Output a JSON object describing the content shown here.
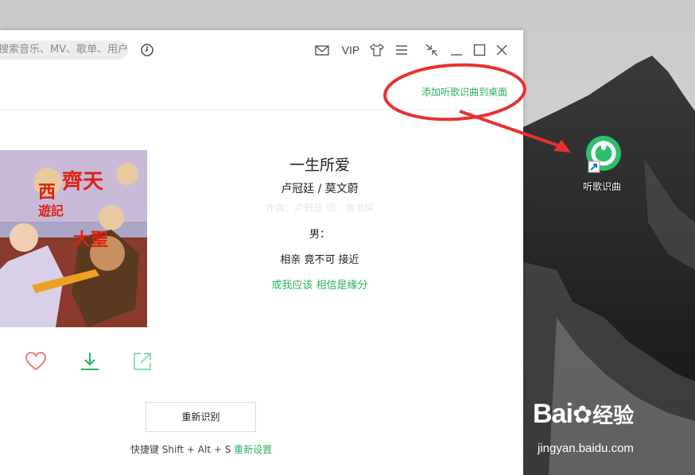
{
  "search": {
    "placeholder": "搜索音乐、MV、歌单、用户"
  },
  "titlebar": {
    "vip_label": "VIP",
    "icons": [
      "music-recognition-icon",
      "mail-icon",
      "skin-tshirt-icon",
      "menu-icon",
      "mini-mode-icon",
      "minimize-icon",
      "maximize-icon",
      "close-icon"
    ]
  },
  "header": {
    "add_to_desktop_link": "添加听歌识曲到桌面"
  },
  "song": {
    "title": "一生所爱",
    "artist": "卢冠廷 / 莫文蔚",
    "faded_line": "作曲：卢冠廷 词：唐书琛",
    "lyrics": [
      "男：",
      "相亲 竟不可 接近",
      "或我应该 相信是缘分"
    ]
  },
  "actions": {
    "icons": [
      "heart-icon",
      "download-icon",
      "share-icon"
    ]
  },
  "recognize_again_button": "重新识别",
  "hotkey": {
    "text": "快捷键 Shift + Alt + S",
    "reset_link": "重新设置"
  },
  "desktop_shortcut": {
    "label": "听歌识曲"
  },
  "watermark": {
    "logo_text": "Bai",
    "logo_cn": "经验",
    "url": "jingyan.baidu.com"
  },
  "colors": {
    "accent_green": "#2eae62",
    "annotation_red": "#e8312f",
    "heart_red": "#f07a7a"
  }
}
